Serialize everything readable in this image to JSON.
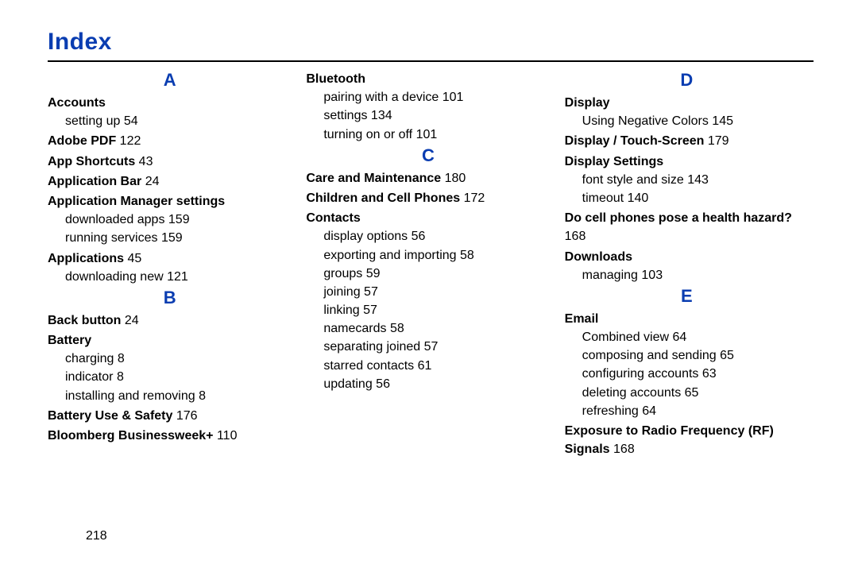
{
  "title": "Index",
  "page_number": "218",
  "columns": [
    {
      "sections": [
        {
          "letter": "A",
          "entries": [
            {
              "title": "Accounts",
              "subs": [
                {
                  "text": "setting up",
                  "page": "54"
                }
              ]
            },
            {
              "title": "Adobe PDF",
              "page": "122"
            },
            {
              "title": "App Shortcuts",
              "page": "43"
            },
            {
              "title": "Application Bar",
              "page": "24"
            },
            {
              "title": "Application Manager settings",
              "subs": [
                {
                  "text": "downloaded apps",
                  "page": "159"
                },
                {
                  "text": "running services",
                  "page": "159"
                }
              ]
            },
            {
              "title": "Applications",
              "page": "45",
              "subs": [
                {
                  "text": "downloading new",
                  "page": "121"
                }
              ]
            }
          ]
        },
        {
          "letter": "B",
          "entries": [
            {
              "title": "Back button",
              "page": "24"
            },
            {
              "title": "Battery",
              "subs": [
                {
                  "text": "charging",
                  "page": "8"
                },
                {
                  "text": "indicator",
                  "page": "8"
                },
                {
                  "text": "installing and removing",
                  "page": "8"
                }
              ]
            },
            {
              "title": "Battery Use & Safety",
              "page": "176"
            },
            {
              "title": "Bloomberg Businessweek+",
              "page": "110"
            }
          ]
        }
      ]
    },
    {
      "sections": [
        {
          "letter": "",
          "entries": [
            {
              "title": "Bluetooth",
              "subs": [
                {
                  "text": "pairing with a device",
                  "page": "101"
                },
                {
                  "text": "settings",
                  "page": "134"
                },
                {
                  "text": "turning on or off",
                  "page": "101"
                }
              ]
            }
          ]
        },
        {
          "letter": "C",
          "entries": [
            {
              "title": "Care and Maintenance",
              "page": "180"
            },
            {
              "title": "Children and Cell Phones",
              "page": "172"
            },
            {
              "title": "Contacts",
              "subs": [
                {
                  "text": "display options",
                  "page": "56"
                },
                {
                  "text": "exporting and importing",
                  "page": "58"
                },
                {
                  "text": "groups",
                  "page": "59"
                },
                {
                  "text": "joining",
                  "page": "57"
                },
                {
                  "text": "linking",
                  "page": "57"
                },
                {
                  "text": "namecards",
                  "page": "58"
                },
                {
                  "text": "separating joined",
                  "page": "57"
                },
                {
                  "text": "starred contacts",
                  "page": "61"
                },
                {
                  "text": "updating",
                  "page": "56"
                }
              ]
            }
          ]
        }
      ]
    },
    {
      "sections": [
        {
          "letter": "D",
          "entries": [
            {
              "title": "Display",
              "subs": [
                {
                  "text": "Using Negative Colors",
                  "page": "145"
                }
              ]
            },
            {
              "title": "Display / Touch-Screen",
              "page": "179"
            },
            {
              "title": "Display Settings",
              "subs": [
                {
                  "text": "font style and size",
                  "page": "143"
                },
                {
                  "text": "timeout",
                  "page": "140"
                }
              ]
            },
            {
              "title": "Do cell phones pose a health hazard?",
              "page": "168"
            },
            {
              "title": "Downloads",
              "subs": [
                {
                  "text": "managing",
                  "page": "103"
                }
              ]
            }
          ]
        },
        {
          "letter": "E",
          "entries": [
            {
              "title": "Email",
              "subs": [
                {
                  "text": "Combined view",
                  "page": "64"
                },
                {
                  "text": "composing and sending",
                  "page": "65"
                },
                {
                  "text": "configuring accounts",
                  "page": "63"
                },
                {
                  "text": "deleting accounts",
                  "page": "65"
                },
                {
                  "text": "refreshing",
                  "page": "64"
                }
              ]
            },
            {
              "title": "Exposure to Radio Frequency (RF) Signals",
              "page": "168"
            }
          ]
        }
      ]
    }
  ]
}
